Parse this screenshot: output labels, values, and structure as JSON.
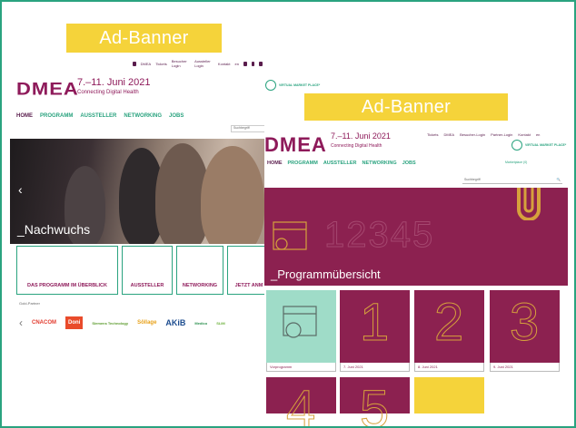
{
  "ads": {
    "top_left": "Ad-Banner",
    "right": "Ad-Banner"
  },
  "page1": {
    "topbar": [
      "DMEA",
      "Tickets",
      "Besucher Login",
      "Aussteller Login",
      "Kontakt",
      "en"
    ],
    "logo": "DMEA",
    "dates": "7.–11. Juni 2021",
    "subtitle": "Connecting Digital Health",
    "nav": [
      "HOME",
      "PROGRAMM",
      "AUSSTELLER",
      "NETWORKING",
      "JOBS"
    ],
    "virtual_market": "VIRTUAL MARKET PLACE*",
    "search_placeholder": "Suchbegriff",
    "hero_caption": "_Nachwuchs",
    "hero_arrow": "‹",
    "cards": [
      "DAS PROGRAMM IM ÜBERBLICK",
      "AUSSTELLER",
      "NETWORKING",
      "JETZT ANM"
    ],
    "partners_label": "Gold-Partner",
    "partner_logos": [
      "CNACOM",
      "Doni",
      "Siemens Technology",
      "Söllage",
      "AKiB",
      "Medico",
      "SLIM"
    ],
    "partner_chev": "‹"
  },
  "page2": {
    "topbar": [
      "Tickets",
      "DMEA",
      "Besucher-Login",
      "Partner-Login",
      "Kontakt",
      "en"
    ],
    "logo": "DMEA",
    "dates": "7.–11. Juni 2021",
    "subtitle": "Connecting Digital Health",
    "virtual_market": "VIRTUAL MARKET PLACE*",
    "nav": [
      "HOME",
      "PROGRAMM",
      "AUSSTELLER",
      "NETWORKING",
      "JOBS"
    ],
    "marketplace_link": "Marketplace (0)",
    "search_placeholder": "Suchbegriff",
    "search_icon": "🔍",
    "hero_big_numbers": "12345",
    "hero_caption": "_Programmübersicht",
    "tiles": [
      {
        "label": "Vorprogramm",
        "num": ""
      },
      {
        "label": "7. Juni 2021",
        "num": "1"
      },
      {
        "label": "8. Juni 2021",
        "num": "2"
      },
      {
        "label": "9. Juni 2021",
        "num": "3"
      }
    ],
    "tiles_row2": [
      "4",
      "5"
    ]
  },
  "colors": {
    "frame": "#2aa37f",
    "brand": "#8c2150",
    "green": "#2aa37f",
    "ad": "#f5d33a",
    "mint": "#9fdcc8",
    "gold": "#d6a13c"
  }
}
